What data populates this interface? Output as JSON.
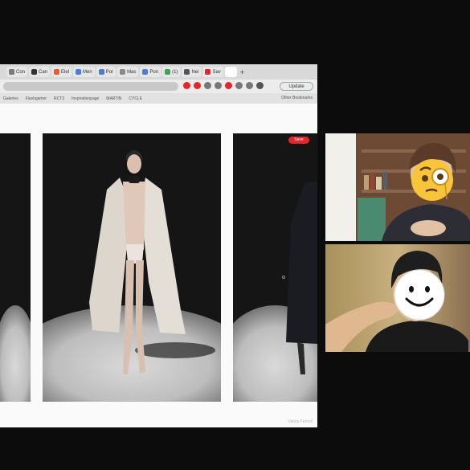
{
  "browser": {
    "tabs": [
      {
        "label": "Con",
        "color": "#7a7a7a"
      },
      {
        "label": "Can",
        "color": "#333333",
        "glyph": "N"
      },
      {
        "label": "Elel",
        "color": "#e85d2a"
      },
      {
        "label": "Men",
        "color": "#4a7fd6"
      },
      {
        "label": "Por",
        "color": "#4a7fd6"
      },
      {
        "label": "Mas",
        "color": "#8a8a8a"
      },
      {
        "label": "Pon",
        "color": "#4a7fd6"
      },
      {
        "label": "(1)",
        "color": "#34a853"
      },
      {
        "label": "Nei",
        "color": "#555555"
      },
      {
        "label": "Sav",
        "color": "#e2262a"
      },
      {
        "label": "",
        "color": "#ffffff",
        "active": true
      }
    ],
    "new_tab": "+",
    "update_label": "Update",
    "bookmarks": [
      "Galeries",
      "Flashgamer",
      "RCT3",
      "Inspirationpage",
      "MARTIN",
      "CYCLE"
    ],
    "other_bookmarks": "Other Bookmarks",
    "toolbar_icon_colors": [
      "#e2262a",
      "#e2262a",
      "#777777",
      "#777777",
      "#e2262a",
      "#777777",
      "#777777",
      "#555555"
    ]
  },
  "page": {
    "save_button": "Save",
    "watermark": "Valery Fernell"
  },
  "participants": [
    {
      "name_icon": "face-with-monocle-emoji",
      "role": "participant-top"
    },
    {
      "name_icon": "smiling-face-emoji",
      "role": "participant-bottom"
    }
  ]
}
